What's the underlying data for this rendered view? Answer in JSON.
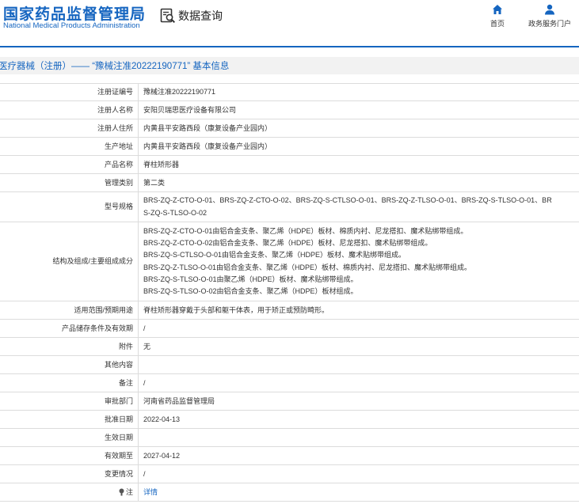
{
  "header": {
    "logo_cn": "国家药品监督管理局",
    "logo_en": "National Medical Products Administration",
    "query_label": "数据查询",
    "nav": [
      {
        "label": "首页",
        "icon": "home-icon"
      },
      {
        "label": "政务服务门户",
        "icon": "user-icon"
      }
    ]
  },
  "title_bar": "医疗器械（注册）—— “豫械注准20222190771” 基本信息",
  "accent_color": "#1565c0",
  "rows": [
    {
      "label": "注册证编号",
      "value": "豫械注准20222190771"
    },
    {
      "label": "注册人名称",
      "value": "安阳贝瑞思医疗设备有限公司"
    },
    {
      "label": "注册人住所",
      "value": "内黄县平安路西段（康复设备产业园内）"
    },
    {
      "label": "生产地址",
      "value": "内黄县平安路西段（康复设备产业园内）"
    },
    {
      "label": "产品名称",
      "value": "脊柱矫形器"
    },
    {
      "label": "管理类别",
      "value": "第二类"
    },
    {
      "label": "型号规格",
      "lines": [
        "BRS-ZQ-Z-CTO-O-01、BRS-ZQ-Z-CTO-O-02、BRS-ZQ-S-CTLSO-O-01、BRS-ZQ-Z-TLSO-O-01、BRS-ZQ-S-TLSO-O-01、BR",
        "S-ZQ-S-TLSO-O-02"
      ]
    },
    {
      "label": "结构及组成/主要组成成分",
      "lines": [
        "BRS-ZQ-Z-CTO-O-01由铝合金支条、聚乙烯（HDPE）板材、棉质内衬、尼龙搭扣、魔术贴绑带组成。",
        "BRS-ZQ-Z-CTO-O-02由铝合金支条、聚乙烯（HDPE）板材、尼龙搭扣、魔术贴绑带组成。",
        "BRS-ZQ-S-CTLSO-O-01由铝合金支条、聚乙烯（HDPE）板材、魔术贴绑带组成。",
        "BRS-ZQ-Z-TLSO-O-01由铝合金支条、聚乙烯（HDPE）板材、棉质内衬、尼龙搭扣、魔术贴绑带组成。",
        "BRS-ZQ-S-TLSO-O-01由聚乙烯（HDPE）板材、魔术贴绑带组成。",
        "BRS-ZQ-S-TLSO-O-02由铝合金支条、聚乙烯（HDPE）板材组成。"
      ]
    },
    {
      "label": "适用范围/预期用途",
      "value": "脊柱矫形器穿戴于头部和躯干体表，用于矫正或预防畸形。"
    },
    {
      "label": "产品储存条件及有效期",
      "value": "/"
    },
    {
      "label": "附件",
      "value": "无"
    },
    {
      "label": "其他内容",
      "value": ""
    },
    {
      "label": "备注",
      "value": "/"
    },
    {
      "label": "审批部门",
      "value": "河南省药品监督管理局"
    },
    {
      "label": "批准日期",
      "value": "2022-04-13"
    },
    {
      "label": "生效日期",
      "value": ""
    },
    {
      "label": "有效期至",
      "value": "2027-04-12"
    },
    {
      "label": "变更情况",
      "value": "/"
    },
    {
      "label": "注",
      "value": "详情",
      "icon": "note-icon",
      "link": true
    }
  ]
}
